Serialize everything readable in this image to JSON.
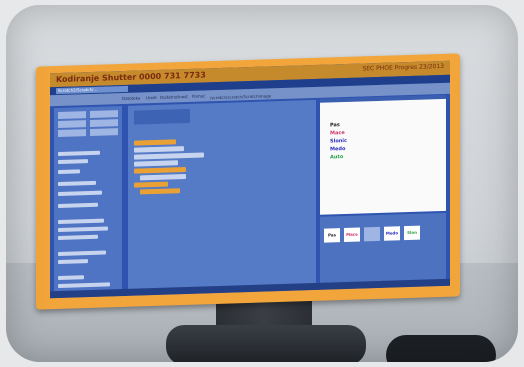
{
  "window": {
    "title": "Kodiranje Shutter 0000 731 7733",
    "right_info": "SEC PHOE  Progres 23/2013",
    "tab_label": "Scratch2/Scratch/...",
    "path": "/scratch/scratch/ScratchImage"
  },
  "menu": [
    "Datoteka",
    "Uredi",
    "Dodatnošnost",
    "Pomoć"
  ],
  "stage_words": [
    {
      "text": "Pas",
      "color": "#222222"
    },
    {
      "text": "Mace",
      "color": "#d0336b"
    },
    {
      "text": "Slonic",
      "color": "#2c2cc0"
    },
    {
      "text": "Medo",
      "color": "#2c2cc0"
    },
    {
      "text": "Auto",
      "color": "#27a043"
    }
  ],
  "sprites": [
    {
      "label": "Pas",
      "color": "#222222"
    },
    {
      "label": "Mace",
      "color": "#d0336b"
    },
    {
      "label": "",
      "color": "#2c2cc0"
    },
    {
      "label": "Medo",
      "color": "#2c2cc0"
    },
    {
      "label": "Slon",
      "color": "#27a043"
    }
  ],
  "colors": {
    "bezel": "#f2a53a",
    "scratch_blue": "#2f54b0",
    "control_block": "#e9a136",
    "data_block": "#c6d4f0"
  }
}
